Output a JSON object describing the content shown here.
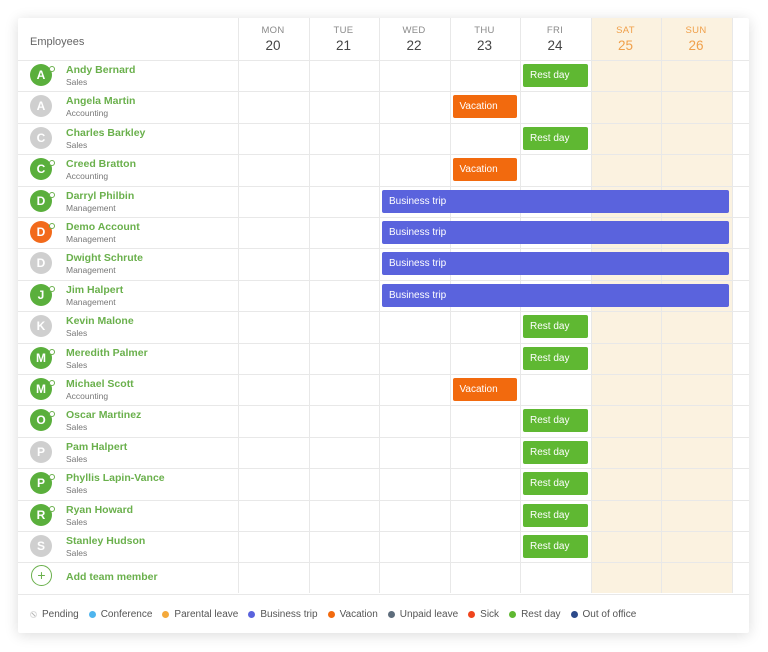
{
  "header": {
    "employees_label": "Employees"
  },
  "days": [
    {
      "name": "MON",
      "date": "20",
      "weekend": false
    },
    {
      "name": "TUE",
      "date": "21",
      "weekend": false
    },
    {
      "name": "WED",
      "date": "22",
      "weekend": false
    },
    {
      "name": "THU",
      "date": "23",
      "weekend": false
    },
    {
      "name": "FRI",
      "date": "24",
      "weekend": false
    },
    {
      "name": "SAT",
      "date": "25",
      "weekend": true
    },
    {
      "name": "SUN",
      "date": "26",
      "weekend": true
    }
  ],
  "employees": [
    {
      "name": "Andy Bernard",
      "dept": "Sales",
      "initial": "A",
      "color": "#5aaf3c",
      "online": true
    },
    {
      "name": "Angela Martin",
      "dept": "Accounting",
      "initial": "A",
      "color": "#cfcfcf",
      "online": false
    },
    {
      "name": "Charles Barkley",
      "dept": "Sales",
      "initial": "C",
      "color": "#cfcfcf",
      "online": false
    },
    {
      "name": "Creed Bratton",
      "dept": "Accounting",
      "initial": "C",
      "color": "#5aaf3c",
      "online": true
    },
    {
      "name": "Darryl Philbin",
      "dept": "Management",
      "initial": "D",
      "color": "#5aaf3c",
      "online": true
    },
    {
      "name": "Demo Account",
      "dept": "Management",
      "initial": "D",
      "color": "#f26a1b",
      "online": true
    },
    {
      "name": "Dwight Schrute",
      "dept": "Management",
      "initial": "D",
      "color": "#cfcfcf",
      "online": false
    },
    {
      "name": "Jim Halpert",
      "dept": "Management",
      "initial": "J",
      "color": "#5aaf3c",
      "online": true
    },
    {
      "name": "Kevin Malone",
      "dept": "Sales",
      "initial": "K",
      "color": "#cfcfcf",
      "online": false
    },
    {
      "name": "Meredith Palmer",
      "dept": "Sales",
      "initial": "M",
      "color": "#5aaf3c",
      "online": true
    },
    {
      "name": "Michael Scott",
      "dept": "Accounting",
      "initial": "M",
      "color": "#5aaf3c",
      "online": true
    },
    {
      "name": "Oscar Martinez",
      "dept": "Sales",
      "initial": "O",
      "color": "#5aaf3c",
      "online": true
    },
    {
      "name": "Pam Halpert",
      "dept": "Sales",
      "initial": "P",
      "color": "#cfcfcf",
      "online": false
    },
    {
      "name": "Phyllis Lapin-Vance",
      "dept": "Sales",
      "initial": "P",
      "color": "#5aaf3c",
      "online": true
    },
    {
      "name": "Ryan Howard",
      "dept": "Sales",
      "initial": "R",
      "color": "#5aaf3c",
      "online": true
    },
    {
      "name": "Stanley Hudson",
      "dept": "Sales",
      "initial": "S",
      "color": "#cfcfcf",
      "online": false
    }
  ],
  "events": [
    {
      "row": 0,
      "start": 4,
      "end": 4,
      "label": "Rest day",
      "type": "rest"
    },
    {
      "row": 1,
      "start": 3,
      "end": 3,
      "label": "Vacation",
      "type": "vacation"
    },
    {
      "row": 2,
      "start": 4,
      "end": 4,
      "label": "Rest day",
      "type": "rest"
    },
    {
      "row": 3,
      "start": 3,
      "end": 3,
      "label": "Vacation",
      "type": "vacation"
    },
    {
      "row": 4,
      "start": 2,
      "end": 6,
      "label": "Business trip",
      "type": "trip"
    },
    {
      "row": 5,
      "start": 2,
      "end": 6,
      "label": "Business trip",
      "type": "trip"
    },
    {
      "row": 6,
      "start": 2,
      "end": 6,
      "label": "Business trip",
      "type": "trip"
    },
    {
      "row": 7,
      "start": 2,
      "end": 6,
      "label": "Business trip",
      "type": "trip"
    },
    {
      "row": 8,
      "start": 4,
      "end": 4,
      "label": "Rest day",
      "type": "rest"
    },
    {
      "row": 9,
      "start": 4,
      "end": 4,
      "label": "Rest day",
      "type": "rest"
    },
    {
      "row": 10,
      "start": 3,
      "end": 3,
      "label": "Vacation",
      "type": "vacation"
    },
    {
      "row": 11,
      "start": 4,
      "end": 4,
      "label": "Rest day",
      "type": "rest"
    },
    {
      "row": 12,
      "start": 4,
      "end": 4,
      "label": "Rest day",
      "type": "rest"
    },
    {
      "row": 13,
      "start": 4,
      "end": 4,
      "label": "Rest day",
      "type": "rest"
    },
    {
      "row": 14,
      "start": 4,
      "end": 4,
      "label": "Rest day",
      "type": "rest"
    },
    {
      "row": 15,
      "start": 4,
      "end": 4,
      "label": "Rest day",
      "type": "rest"
    }
  ],
  "event_colors": {
    "rest": "#5fb832",
    "vacation": "#f26a0e",
    "trip": "#5a63dd"
  },
  "add_member": {
    "icon": "+",
    "label": "Add team member"
  },
  "legend": [
    {
      "label": "Pending",
      "color": "pattern"
    },
    {
      "label": "Conference",
      "color": "#4fb5ee"
    },
    {
      "label": "Parental leave",
      "color": "#f4a93b"
    },
    {
      "label": "Business trip",
      "color": "#5a63dd"
    },
    {
      "label": "Vacation",
      "color": "#f26a0e"
    },
    {
      "label": "Unpaid leave",
      "color": "#5e6d7c"
    },
    {
      "label": "Sick",
      "color": "#f0451d"
    },
    {
      "label": "Rest day",
      "color": "#5fb832"
    },
    {
      "label": "Out of office",
      "color": "#2c4a8a"
    }
  ]
}
